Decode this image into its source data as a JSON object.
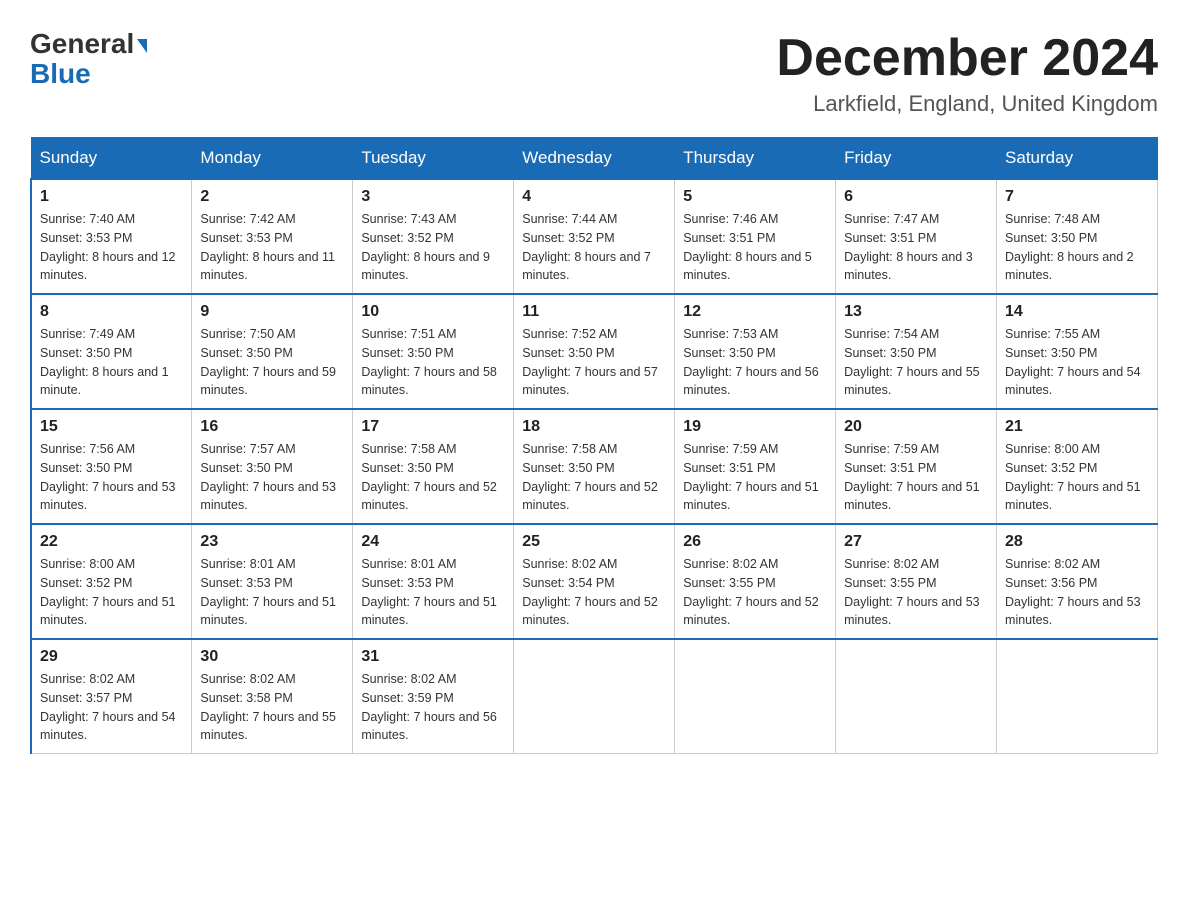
{
  "header": {
    "logo_general": "General",
    "logo_blue": "Blue",
    "month_title": "December 2024",
    "location": "Larkfield, England, United Kingdom"
  },
  "days_of_week": [
    "Sunday",
    "Monday",
    "Tuesday",
    "Wednesday",
    "Thursday",
    "Friday",
    "Saturday"
  ],
  "weeks": [
    [
      {
        "day": "1",
        "sunrise": "7:40 AM",
        "sunset": "3:53 PM",
        "daylight": "8 hours and 12 minutes."
      },
      {
        "day": "2",
        "sunrise": "7:42 AM",
        "sunset": "3:53 PM",
        "daylight": "8 hours and 11 minutes."
      },
      {
        "day": "3",
        "sunrise": "7:43 AM",
        "sunset": "3:52 PM",
        "daylight": "8 hours and 9 minutes."
      },
      {
        "day": "4",
        "sunrise": "7:44 AM",
        "sunset": "3:52 PM",
        "daylight": "8 hours and 7 minutes."
      },
      {
        "day": "5",
        "sunrise": "7:46 AM",
        "sunset": "3:51 PM",
        "daylight": "8 hours and 5 minutes."
      },
      {
        "day": "6",
        "sunrise": "7:47 AM",
        "sunset": "3:51 PM",
        "daylight": "8 hours and 3 minutes."
      },
      {
        "day": "7",
        "sunrise": "7:48 AM",
        "sunset": "3:50 PM",
        "daylight": "8 hours and 2 minutes."
      }
    ],
    [
      {
        "day": "8",
        "sunrise": "7:49 AM",
        "sunset": "3:50 PM",
        "daylight": "8 hours and 1 minute."
      },
      {
        "day": "9",
        "sunrise": "7:50 AM",
        "sunset": "3:50 PM",
        "daylight": "7 hours and 59 minutes."
      },
      {
        "day": "10",
        "sunrise": "7:51 AM",
        "sunset": "3:50 PM",
        "daylight": "7 hours and 58 minutes."
      },
      {
        "day": "11",
        "sunrise": "7:52 AM",
        "sunset": "3:50 PM",
        "daylight": "7 hours and 57 minutes."
      },
      {
        "day": "12",
        "sunrise": "7:53 AM",
        "sunset": "3:50 PM",
        "daylight": "7 hours and 56 minutes."
      },
      {
        "day": "13",
        "sunrise": "7:54 AM",
        "sunset": "3:50 PM",
        "daylight": "7 hours and 55 minutes."
      },
      {
        "day": "14",
        "sunrise": "7:55 AM",
        "sunset": "3:50 PM",
        "daylight": "7 hours and 54 minutes."
      }
    ],
    [
      {
        "day": "15",
        "sunrise": "7:56 AM",
        "sunset": "3:50 PM",
        "daylight": "7 hours and 53 minutes."
      },
      {
        "day": "16",
        "sunrise": "7:57 AM",
        "sunset": "3:50 PM",
        "daylight": "7 hours and 53 minutes."
      },
      {
        "day": "17",
        "sunrise": "7:58 AM",
        "sunset": "3:50 PM",
        "daylight": "7 hours and 52 minutes."
      },
      {
        "day": "18",
        "sunrise": "7:58 AM",
        "sunset": "3:50 PM",
        "daylight": "7 hours and 52 minutes."
      },
      {
        "day": "19",
        "sunrise": "7:59 AM",
        "sunset": "3:51 PM",
        "daylight": "7 hours and 51 minutes."
      },
      {
        "day": "20",
        "sunrise": "7:59 AM",
        "sunset": "3:51 PM",
        "daylight": "7 hours and 51 minutes."
      },
      {
        "day": "21",
        "sunrise": "8:00 AM",
        "sunset": "3:52 PM",
        "daylight": "7 hours and 51 minutes."
      }
    ],
    [
      {
        "day": "22",
        "sunrise": "8:00 AM",
        "sunset": "3:52 PM",
        "daylight": "7 hours and 51 minutes."
      },
      {
        "day": "23",
        "sunrise": "8:01 AM",
        "sunset": "3:53 PM",
        "daylight": "7 hours and 51 minutes."
      },
      {
        "day": "24",
        "sunrise": "8:01 AM",
        "sunset": "3:53 PM",
        "daylight": "7 hours and 51 minutes."
      },
      {
        "day": "25",
        "sunrise": "8:02 AM",
        "sunset": "3:54 PM",
        "daylight": "7 hours and 52 minutes."
      },
      {
        "day": "26",
        "sunrise": "8:02 AM",
        "sunset": "3:55 PM",
        "daylight": "7 hours and 52 minutes."
      },
      {
        "day": "27",
        "sunrise": "8:02 AM",
        "sunset": "3:55 PM",
        "daylight": "7 hours and 53 minutes."
      },
      {
        "day": "28",
        "sunrise": "8:02 AM",
        "sunset": "3:56 PM",
        "daylight": "7 hours and 53 minutes."
      }
    ],
    [
      {
        "day": "29",
        "sunrise": "8:02 AM",
        "sunset": "3:57 PM",
        "daylight": "7 hours and 54 minutes."
      },
      {
        "day": "30",
        "sunrise": "8:02 AM",
        "sunset": "3:58 PM",
        "daylight": "7 hours and 55 minutes."
      },
      {
        "day": "31",
        "sunrise": "8:02 AM",
        "sunset": "3:59 PM",
        "daylight": "7 hours and 56 minutes."
      },
      null,
      null,
      null,
      null
    ]
  ],
  "labels": {
    "sunrise_prefix": "Sunrise: ",
    "sunset_prefix": "Sunset: ",
    "daylight_prefix": "Daylight: "
  }
}
